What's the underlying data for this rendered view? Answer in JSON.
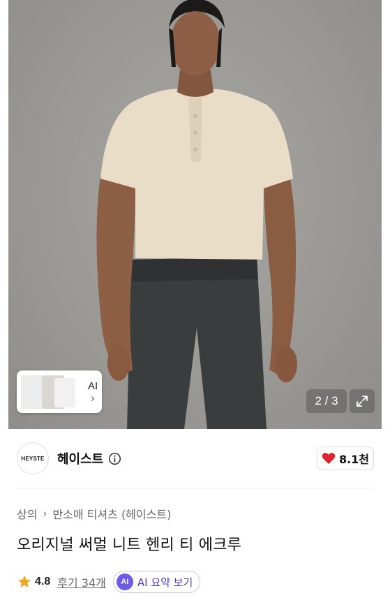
{
  "gallery": {
    "counter": "2 / 3",
    "ai_thumb_label": "AI",
    "ai_thumb_chevron": "›",
    "expand_icon": "expand-icon"
  },
  "brand": {
    "logo_text": "HEYSTE",
    "name": "헤이스트",
    "info_icon": "info-icon"
  },
  "like": {
    "icon": "heart-icon",
    "count": "8.1천",
    "color": "#e0242f"
  },
  "breadcrumb": {
    "level1": "상의",
    "separator": "›",
    "level2": "반소매 티셔츠 (헤이스트)"
  },
  "product": {
    "title": "오리지널 써멀 니트 헨리 티 에크루"
  },
  "rating": {
    "star_icon": "star-icon",
    "star_color": "#f4a623",
    "value": "4.8",
    "review_link": "후기 34개",
    "ai_badge": "AI",
    "ai_summary_label": "AI 요약 보기",
    "ai_color": "#6c5ce7"
  }
}
